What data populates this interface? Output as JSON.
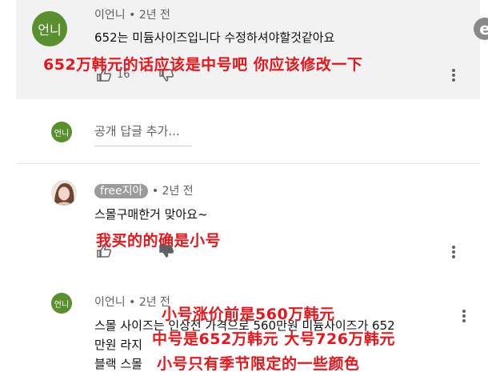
{
  "comment1": {
    "avatar_text": "언니",
    "author": "이언니",
    "time": "2년 전",
    "text": "652는 미듐사이즈입니다 수정하셔야할것같아요",
    "overlay": "652万韩元的话应该是中号吧 你应该修改一下",
    "like_count": "16"
  },
  "reply_box": {
    "avatar_text": "언니",
    "placeholder": "공개 답글 추가..."
  },
  "comment2": {
    "author": "free지아",
    "time": "2년 전",
    "text": "스몰구매한거 맞아요~",
    "overlay": "我买的的确是小号"
  },
  "comment3": {
    "avatar_text": "언니",
    "author": "이언니",
    "time": "2년 전",
    "text_line1": "스몰 사이즈는 인상전 가격으로 560만원 미듐사이즈가 652",
    "text_line2": "만원 라지",
    "text_line3": "블랙 스몰",
    "overlay_line1": "小号涨价前是560万韩元",
    "overlay_line2": "中号是652万韩元 大号726万韩元",
    "overlay_line3": "小号只有季节限定的一些颜色"
  },
  "side_glyph": "e"
}
